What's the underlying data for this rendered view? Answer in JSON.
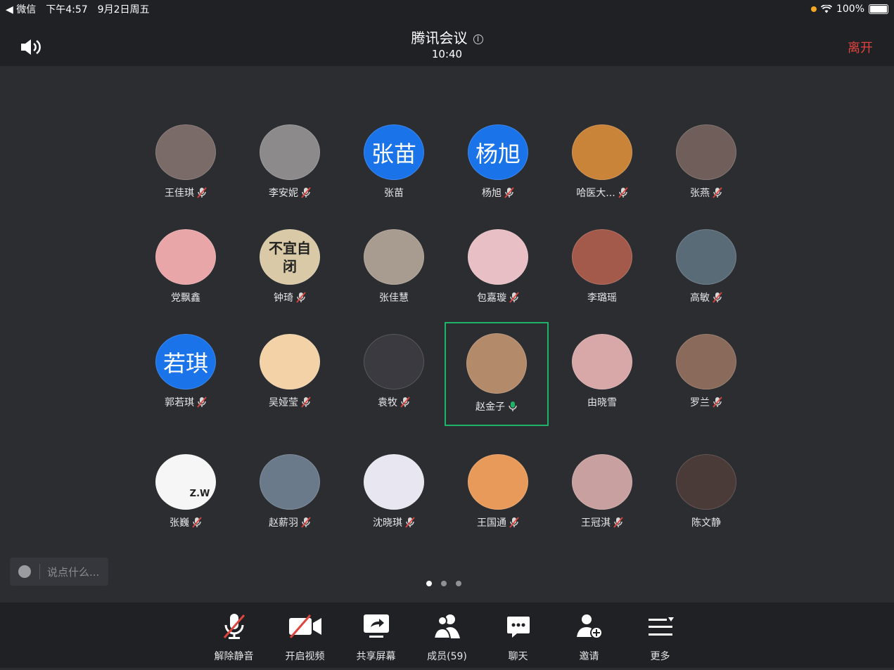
{
  "status_bar": {
    "back_app": "◀ 微信",
    "time": "下午4:57",
    "date": "9月2日周五",
    "battery": "100%"
  },
  "header": {
    "title": "腾讯会议",
    "timer": "10:40",
    "leave_label": "离开"
  },
  "participants": [
    {
      "name": "王佳琪",
      "muted": true,
      "avatar_color": "#7a6a68",
      "initials": ""
    },
    {
      "name": "李安妮",
      "muted": true,
      "avatar_color": "#8c8a8a",
      "initials": ""
    },
    {
      "name": "张苗",
      "muted": false,
      "avatar_color": "#1a73e8",
      "initials": "张苗"
    },
    {
      "name": "杨旭",
      "muted": true,
      "avatar_color": "#1a73e8",
      "initials": "杨旭"
    },
    {
      "name": "哈医大...",
      "muted": true,
      "avatar_color": "#c9843a",
      "initials": ""
    },
    {
      "name": "张燕",
      "muted": true,
      "avatar_color": "#6f5e5a",
      "initials": ""
    },
    {
      "name": "党飘鑫",
      "muted": false,
      "avatar_color": "#e8a6a8",
      "initials": ""
    },
    {
      "name": "钟琦",
      "muted": true,
      "avatar_color": "#d9c9a6",
      "initials": "不宜自闭"
    },
    {
      "name": "张佳慧",
      "muted": false,
      "avatar_color": "#a89c90",
      "initials": ""
    },
    {
      "name": "包嘉璇",
      "muted": true,
      "avatar_color": "#e8bfc4",
      "initials": ""
    },
    {
      "name": "李璐瑶",
      "muted": false,
      "avatar_color": "#a45a4a",
      "initials": ""
    },
    {
      "name": "高敏",
      "muted": true,
      "avatar_color": "#5a6b78",
      "initials": ""
    },
    {
      "name": "郭若琪",
      "muted": true,
      "avatar_color": "#1a73e8",
      "initials": "若琪"
    },
    {
      "name": "吴娅莹",
      "muted": true,
      "avatar_color": "#f2d2a6",
      "initials": ""
    },
    {
      "name": "袁牧",
      "muted": true,
      "avatar_color": "#3a3a40",
      "initials": ""
    },
    {
      "name": "赵金子",
      "muted": false,
      "speaking": true,
      "avatar_color": "#b38a6a",
      "initials": ""
    },
    {
      "name": "由晓雪",
      "muted": false,
      "avatar_color": "#d8a8a8",
      "initials": ""
    },
    {
      "name": "罗兰",
      "muted": true,
      "avatar_color": "#8a6a5a",
      "initials": ""
    },
    {
      "name": "张巍",
      "muted": true,
      "avatar_color": "#f6f6f6",
      "initials": "Z.W"
    },
    {
      "name": "赵薪羽",
      "muted": true,
      "avatar_color": "#6a7a8a",
      "initials": ""
    },
    {
      "name": "沈晓琪",
      "muted": true,
      "avatar_color": "#e8e6f0",
      "initials": ""
    },
    {
      "name": "王国通",
      "muted": true,
      "avatar_color": "#e89a5a",
      "initials": ""
    },
    {
      "name": "王冠淇",
      "muted": true,
      "avatar_color": "#c8a0a0",
      "initials": ""
    },
    {
      "name": "陈文静",
      "muted": false,
      "avatar_color": "#4a3a38",
      "initials": ""
    }
  ],
  "chat": {
    "placeholder": "说点什么..."
  },
  "pager": {
    "pages": 3,
    "current": 1
  },
  "toolbar": [
    {
      "id": "unmute",
      "label": "解除静音",
      "icon": "mic-off-icon"
    },
    {
      "id": "video",
      "label": "开启视频",
      "icon": "video-off-icon"
    },
    {
      "id": "share",
      "label": "共享屏幕",
      "icon": "share-screen-icon"
    },
    {
      "id": "members",
      "label": "成员(59)",
      "icon": "members-icon"
    },
    {
      "id": "chat",
      "label": "聊天",
      "icon": "chat-icon"
    },
    {
      "id": "invite",
      "label": "邀请",
      "icon": "invite-icon"
    },
    {
      "id": "more",
      "label": "更多",
      "icon": "more-icon"
    }
  ],
  "colors": {
    "accent_red": "#e0443e",
    "speaking_green": "#1fb36a",
    "blue_avatar": "#1a73e8"
  }
}
